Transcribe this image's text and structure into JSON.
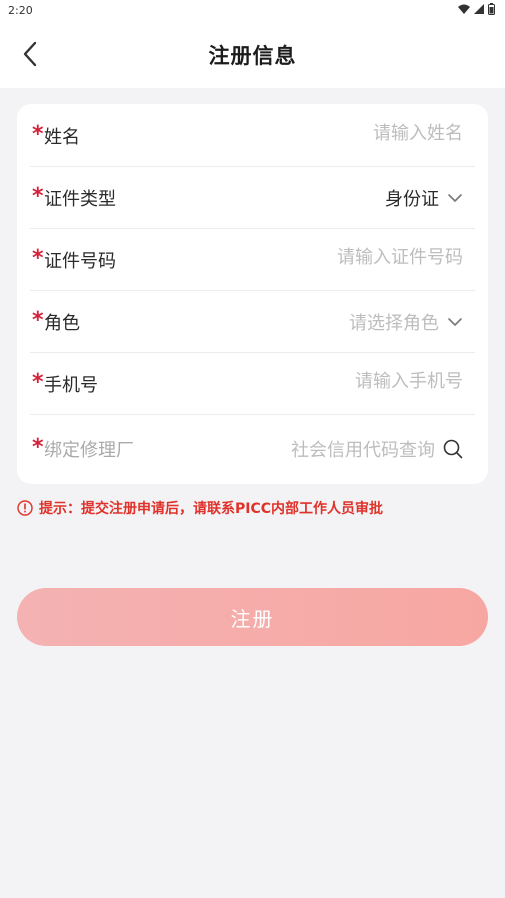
{
  "status_bar": {
    "time": "2:20"
  },
  "header": {
    "title": "注册信息"
  },
  "form": {
    "required_mark": "*",
    "name": {
      "label": "姓名",
      "placeholder": "请输入姓名"
    },
    "id_type": {
      "label": "证件类型",
      "value": "身份证"
    },
    "id_number": {
      "label": "证件号码",
      "placeholder": "请输入证件号码"
    },
    "role": {
      "label": "角色",
      "placeholder": "请选择角色"
    },
    "phone": {
      "label": "手机号",
      "placeholder": "请输入手机号"
    },
    "repair_shop": {
      "label": "绑定修理厂",
      "placeholder": "社会信用代码查询"
    }
  },
  "hint": {
    "text": "提示：提交注册申请后，请联系PICC内部工作人员审批"
  },
  "register_button": {
    "label": "注册"
  },
  "colors": {
    "required": "#d6203b",
    "hint": "#e0322a",
    "button": "#f6acaa"
  }
}
